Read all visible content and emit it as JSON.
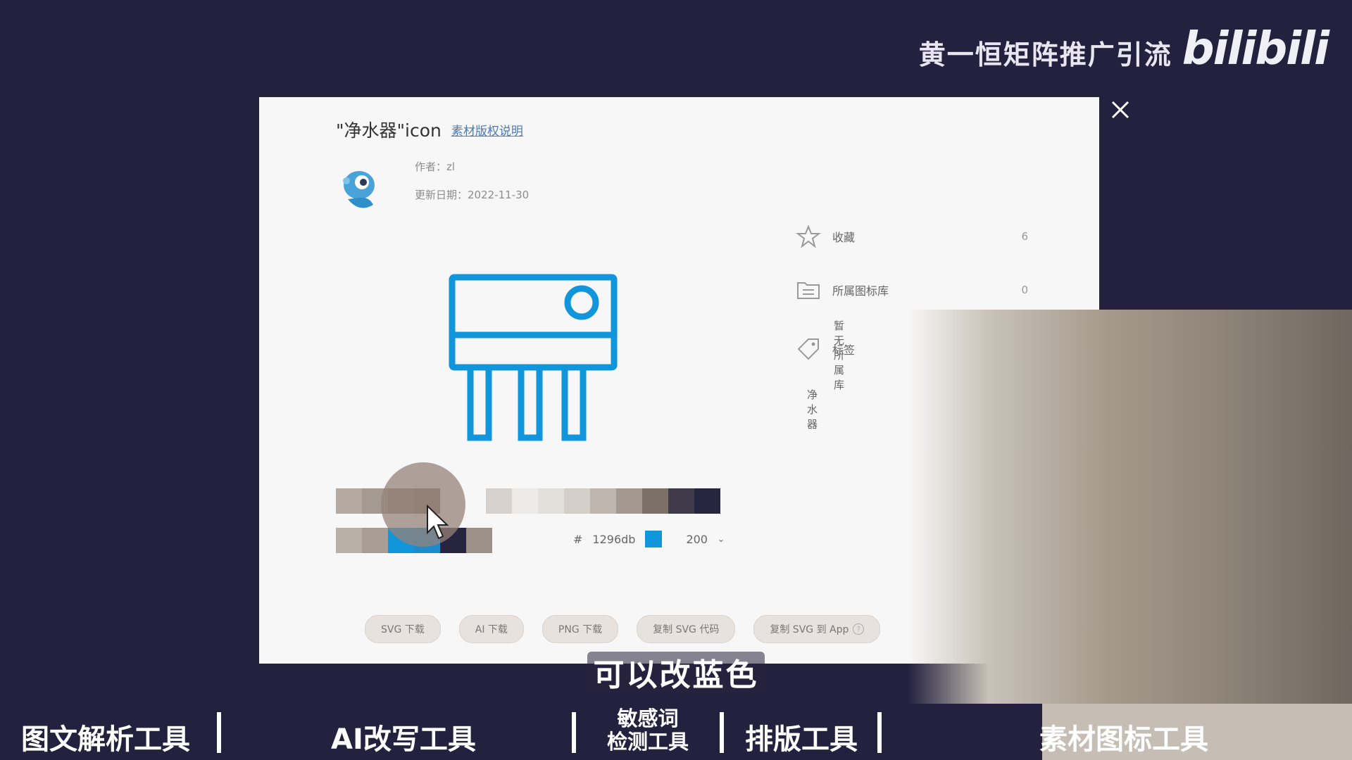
{
  "brand": {
    "text": "黄一恒矩阵推广引流",
    "logo": "bilibili"
  },
  "modal": {
    "title": "\"净水器\"icon",
    "license_link": "素材版权说明",
    "author": "作者：zl",
    "update_date": "更新日期：2022-11-30",
    "side": {
      "favorite_label": "收藏",
      "favorite_count": "6",
      "library_label": "所属图标库",
      "library_count": "0",
      "library_empty": "暂无所属库",
      "tags_label": "标签",
      "tag_item": "净水器"
    },
    "color": {
      "hash": "#",
      "hex": "1296db",
      "value": "#1296db"
    },
    "size": {
      "value": "200"
    },
    "buttons": [
      "SVG 下载",
      "AI 下载",
      "PNG 下载",
      "复制 SVG 代码",
      "复制 SVG 到 App"
    ]
  },
  "swatches": {
    "row1": [
      "#b4aaa1",
      "#a49a90",
      "#938980",
      "#857b72",
      "#d6d1cc",
      "#ece9e6",
      "#e3dfdb",
      "#d4cec9",
      "#bdb5ae",
      "#a39990",
      "#7a7068",
      "#3f3b4a",
      "#262640"
    ],
    "row2": [
      "#b9b0a7",
      "#a89e95",
      "#1296db",
      "#1a8cc9",
      "#26243e",
      "#9c9188"
    ]
  },
  "subtitle": "可以改蓝色",
  "bottom_bar": {
    "items": [
      "图文解析工具",
      "AI改写工具",
      "敏感词",
      "检测工具",
      "排版工具",
      "素材图标工具"
    ]
  },
  "colors": {
    "accent": "#1296db",
    "background": "#24213f"
  }
}
